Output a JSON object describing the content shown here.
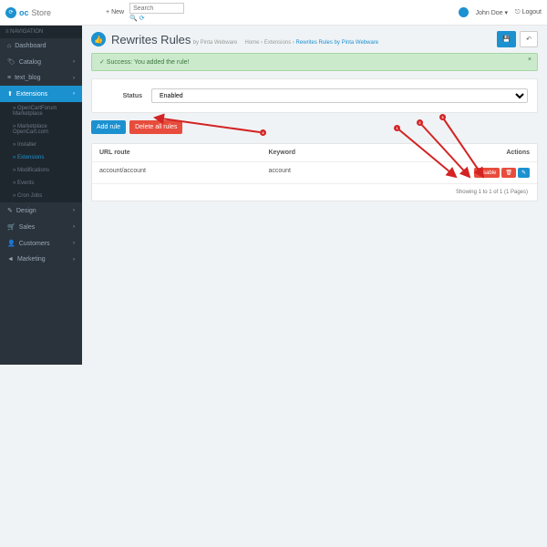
{
  "brand": {
    "logo_text1": "oc",
    "logo_text2": "Store"
  },
  "topbar": {
    "new_label": "+ New",
    "search_placeholder": "Search",
    "user_name": "John Doe ▾",
    "logout_label": "Logout"
  },
  "sidebar": {
    "header": "NAVIGATION",
    "items": [
      {
        "icon": "⌂",
        "label": "Dashboard"
      },
      {
        "icon": "🏷",
        "label": "Catalog",
        "has_children": true
      },
      {
        "icon": "≡",
        "label": "text_blog",
        "has_children": true
      },
      {
        "icon": "⬆",
        "label": "Extensions",
        "has_children": true,
        "active": true
      },
      {
        "icon": "✎",
        "label": "Design",
        "has_children": true
      },
      {
        "icon": "🛒",
        "label": "Sales",
        "has_children": true
      },
      {
        "icon": "👤",
        "label": "Customers",
        "has_children": true
      },
      {
        "icon": "◄",
        "label": "Marketing",
        "has_children": true
      }
    ],
    "sub_items": [
      {
        "label": "OpenCartForum Marketplace"
      },
      {
        "label": "Marketplace OpenCart.com"
      },
      {
        "label": "Installer"
      },
      {
        "label": "Extensions",
        "active": true
      },
      {
        "label": "Modifications"
      },
      {
        "label": "Events"
      },
      {
        "label": "Cron Jobs"
      }
    ]
  },
  "page": {
    "title": "Rewrites Rules",
    "subtitle": "by Pinta Webware",
    "breadcrumb": {
      "home": "Home",
      "sep": " › ",
      "ext": "Extensions",
      "current": "Rewrites Rules by Pinta Webware"
    },
    "save_icon": "💾",
    "back_icon": "↶"
  },
  "alert": {
    "text": "✓ Success: You added the rule!"
  },
  "form": {
    "status_label": "Status",
    "status_value": "Enabled"
  },
  "buttons": {
    "add_rule": "Add rule",
    "delete_all": "Delete all rules"
  },
  "table": {
    "headers": {
      "route": "URL route",
      "keyword": "Keyword",
      "actions": "Actions"
    },
    "rows": [
      {
        "route": "account/account",
        "keyword": "account",
        "disable": "Disable"
      }
    ],
    "pagination": "Showing 1 to 1 of 1 (1 Pages)"
  },
  "annotations": {
    "n1": "1",
    "n2": "2",
    "n3": "3",
    "n4": "4"
  }
}
